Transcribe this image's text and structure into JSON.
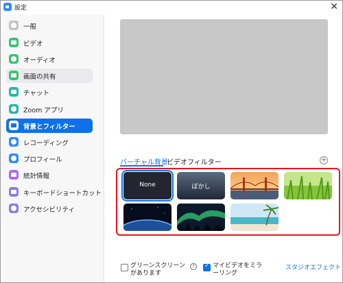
{
  "window": {
    "title": "設定",
    "close_glyph": "✕"
  },
  "sidebar": {
    "items": [
      {
        "label": "一般",
        "icon": "gear-icon",
        "color": "#bdbdbd"
      },
      {
        "label": "ビデオ",
        "icon": "video-icon",
        "color": "#3cc276"
      },
      {
        "label": "オーディオ",
        "icon": "headphones-icon",
        "color": "#3cc276"
      },
      {
        "label": "画面の共有",
        "icon": "share-screen-icon",
        "color": "#3cc276"
      },
      {
        "label": "チャット",
        "icon": "chat-icon",
        "color": "#27b8a6"
      },
      {
        "label": "Zoom アプリ",
        "icon": "apps-icon",
        "color": "#27b8a6"
      },
      {
        "label": "背景とフィルター",
        "icon": "background-icon",
        "color": "#0e71eb"
      },
      {
        "label": "レコーディング",
        "icon": "record-icon",
        "color": "#2d8cff"
      },
      {
        "label": "プロフィール",
        "icon": "profile-icon",
        "color": "#2d8cff"
      },
      {
        "label": "統計情報",
        "icon": "statistics-icon",
        "color": "#a66cf0"
      },
      {
        "label": "キーボードショートカット",
        "icon": "keyboard-icon",
        "color": "#8a7fe0"
      },
      {
        "label": "アクセシビリティ",
        "icon": "accessibility-icon",
        "color": "#8a7fe0"
      }
    ],
    "active_index": 6
  },
  "tabs": {
    "virtual_bg": "バーチャル背景",
    "video_filter": "ビデオフィルター",
    "add_glyph": "+"
  },
  "backgrounds": [
    {
      "label": "None",
      "kind": "none",
      "selected": true
    },
    {
      "label": "ぼかし",
      "kind": "blur",
      "selected": false
    },
    {
      "label": "",
      "kind": "golden-gate-bridge",
      "selected": false
    },
    {
      "label": "",
      "kind": "grass",
      "selected": false
    },
    {
      "label": "",
      "kind": "earth-from-space",
      "selected": false
    },
    {
      "label": "",
      "kind": "aurora",
      "selected": false
    },
    {
      "label": "",
      "kind": "beach",
      "selected": false
    }
  ],
  "options": {
    "green_screen": "グリーンスクリーンがあります",
    "green_screen_checked": false,
    "mirror": "マイビデオをミラーリング",
    "mirror_checked": true,
    "studio_effects": "スタジオエフェクト",
    "info_glyph": "?"
  },
  "colors": {
    "accent": "#0e71eb",
    "highlight_border": "#e8121d"
  }
}
